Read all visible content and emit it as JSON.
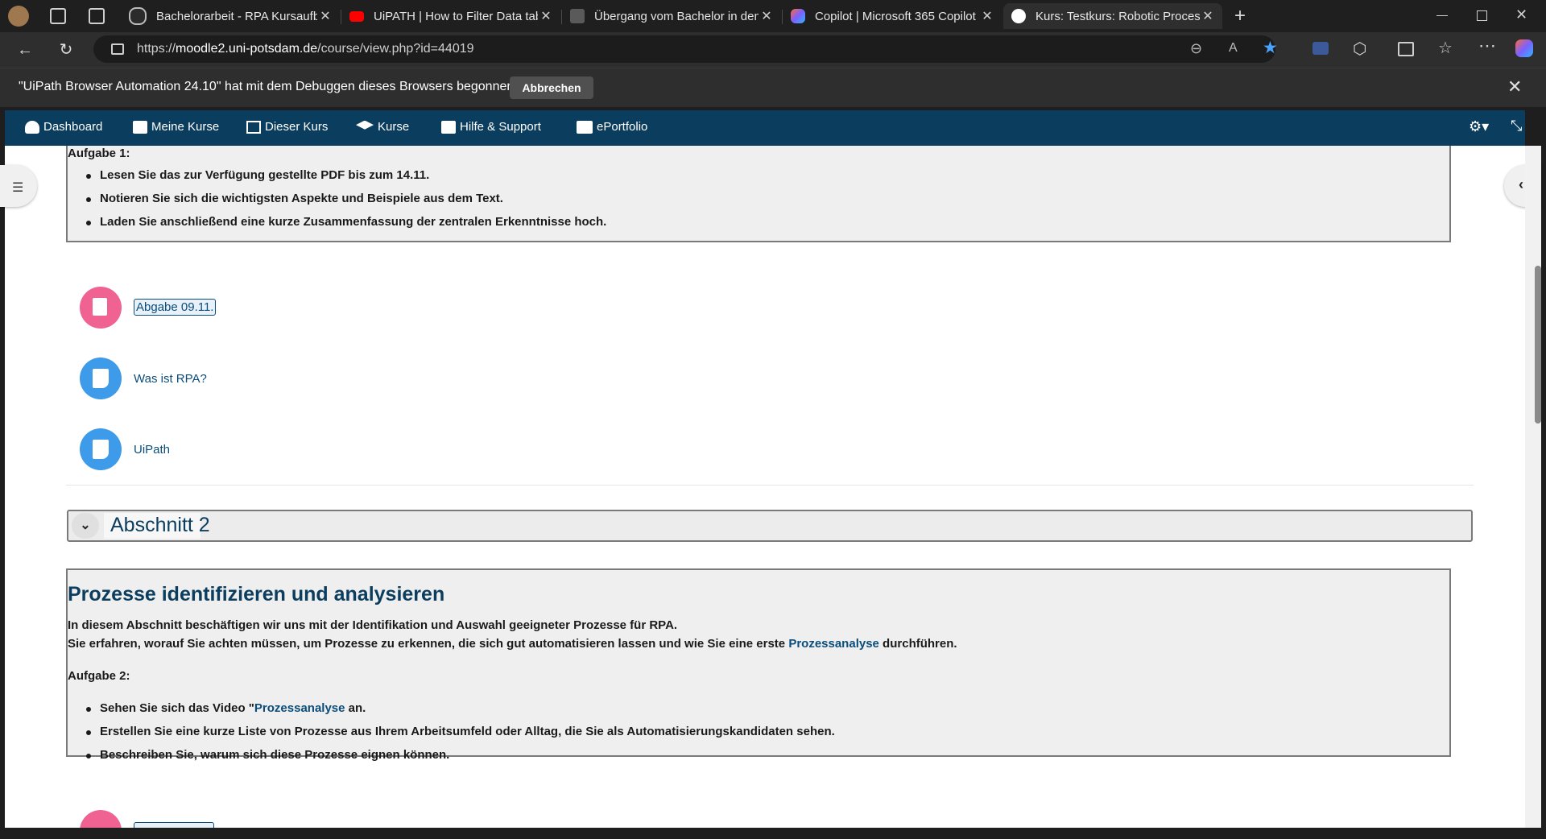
{
  "browser": {
    "tabs": [
      {
        "title": "Bachelorarbeit - RPA Kursaufbau",
        "icon": "openai-icon",
        "color": "#2b2b2b"
      },
      {
        "title": "UiPATH | How to Filter Data table",
        "icon": "youtube-icon",
        "color": "#ff0000"
      },
      {
        "title": "Übergang vom Bachelor in den M",
        "icon": "document-icon",
        "color": "#5a5a5a"
      },
      {
        "title": "Copilot | Microsoft 365 Copilot",
        "icon": "copilot-icon",
        "color": "#7b61ff"
      },
      {
        "title": "Kurs: Testkurs: Robotic Process Au",
        "icon": "moodle-icon",
        "color": "#ffffff"
      }
    ],
    "url_prefix": "https://",
    "url_host": "moodle2.uni-potsdam.de",
    "url_path": "/course/view.php?id=44019"
  },
  "debug_bar": {
    "message": "\"UiPath Browser Automation 24.10\" hat mit dem Debuggen dieses Browsers begonnen.",
    "cancel_label": "Abbrechen"
  },
  "moodle_nav": {
    "items": [
      {
        "label": "Dashboard",
        "icon": "dashboard-icon"
      },
      {
        "label": "Meine Kurse",
        "icon": "briefcase-icon"
      },
      {
        "label": "Dieser Kurs",
        "icon": "sitemap-icon"
      },
      {
        "label": "Kurse",
        "icon": "graduation-cap-icon"
      },
      {
        "label": "Hilfe & Support",
        "icon": "medkit-icon"
      },
      {
        "label": "ePortfolio",
        "icon": "folder-open-icon"
      }
    ]
  },
  "section1": {
    "task_title": "Aufgabe 1:",
    "bullets": [
      "Lesen Sie das zur Verfügung gestellte PDF bis zum 14.11.",
      "Notieren Sie sich die wichtigsten Aspekte und Beispiele aus dem Text.",
      "Laden Sie anschließend eine kurze Zusammenfassung der zentralen Erkenntnisse hoch."
    ],
    "activities": [
      {
        "label": "Abgabe 09.11.",
        "type": "assignment",
        "color": "#f06292"
      },
      {
        "label": "Was ist RPA?",
        "type": "page",
        "color": "#3d9be9"
      },
      {
        "label": "UiPath",
        "type": "page",
        "color": "#3d9be9"
      }
    ]
  },
  "section2": {
    "title": "Abschnitt 2",
    "heading": "Prozesse identifizieren und analysieren",
    "intro_line1": "In diesem Abschnitt beschäftigen wir uns mit der Identifikation und Auswahl geeigneter Prozesse für RPA.",
    "intro_line2_a": "Sie erfahren, worauf Sie achten müssen, um Prozesse zu erkennen, die sich gut automatisieren lassen und wie Sie eine erste ",
    "intro_line2_link": "Prozessanalyse",
    "intro_line2_b": " durchführen.",
    "task_title": "Aufgabe 2:",
    "bullet1_a": "Sehen Sie sich das Video \"",
    "bullet1_link": "Prozessanalyse",
    "bullet1_b": " an.",
    "bullet2": "Erstellen Sie eine kurze Liste von Prozesse aus Ihrem Arbeitsumfeld oder Alltag, die Sie als Automatisierungskandidaten sehen.",
    "bullet3": "Beschreiben Sie, warum sich diese Prozesse eignen können."
  }
}
